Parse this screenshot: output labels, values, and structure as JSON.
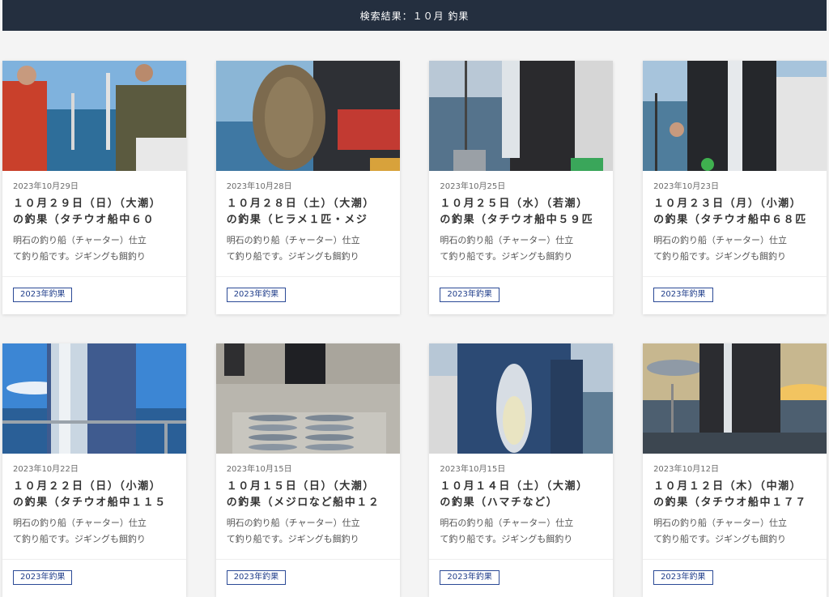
{
  "header": {
    "title": "検索結果：１０月 釣果"
  },
  "colors": {
    "header_bg": "#242f3f",
    "tag_border": "#2b4a96",
    "tag_text": "#1f3d8a"
  },
  "cards": [
    {
      "date": "2023年10月29日",
      "title_l1": "１０月２９日（日）（大潮）",
      "title_l2": "の釣果（タチウオ船中６０",
      "excerpt_l1": "明石の釣り船（チャーター）仕立",
      "excerpt_l2": "て釣り船です。ジギングも餌釣り",
      "tag": "2023年釣果"
    },
    {
      "date": "2023年10月28日",
      "title_l1": "１０月２８日（土）（大潮）",
      "title_l2": "の釣果（ヒラメ１匹・メジ",
      "excerpt_l1": "明石の釣り船（チャーター）仕立",
      "excerpt_l2": "て釣り船です。ジギングも餌釣り",
      "tag": "2023年釣果"
    },
    {
      "date": "2023年10月25日",
      "title_l1": "１０月２５日（水）（若潮）",
      "title_l2": "の釣果（タチウオ船中５９匹",
      "excerpt_l1": "明石の釣り船（チャーター）仕立",
      "excerpt_l2": "て釣り船です。ジギングも餌釣り",
      "tag": "2023年釣果"
    },
    {
      "date": "2023年10月23日",
      "title_l1": "１０月２３日（月）（小潮）",
      "title_l2": "の釣果（タチウオ船中６８匹",
      "excerpt_l1": "明石の釣り船（チャーター）仕立",
      "excerpt_l2": "て釣り船です。ジギングも餌釣り",
      "tag": "2023年釣果"
    },
    {
      "date": "2023年10月22日",
      "title_l1": "１０月２２日（日）（小潮）",
      "title_l2": "の釣果（タチウオ船中１１５",
      "excerpt_l1": "明石の釣り船（チャーター）仕立",
      "excerpt_l2": "て釣り船です。ジギングも餌釣り",
      "tag": "2023年釣果"
    },
    {
      "date": "2023年10月15日",
      "title_l1": "１０月１５日（日）（大潮）",
      "title_l2": "の釣果（メジロなど船中１２",
      "excerpt_l1": "明石の釣り船（チャーター）仕立",
      "excerpt_l2": "て釣り船です。ジギングも餌釣り",
      "tag": "2023年釣果"
    },
    {
      "date": "2023年10月15日",
      "title_l1": "１０月１４日（土）（大潮）",
      "title_l2": "の釣果（ハマチなど）",
      "excerpt_l1": "明石の釣り船（チャーター）仕立",
      "excerpt_l2": "て釣り船です。ジギングも餌釣り",
      "tag": "2023年釣果"
    },
    {
      "date": "2023年10月12日",
      "title_l1": "１０月１２日（木）（中潮）",
      "title_l2": "の釣果（タチウオ船中１７７",
      "excerpt_l1": "明石の釣り船（チャーター）仕立",
      "excerpt_l2": "て釣り船です。ジギングも餌釣り",
      "tag": "2023年釣果"
    }
  ]
}
